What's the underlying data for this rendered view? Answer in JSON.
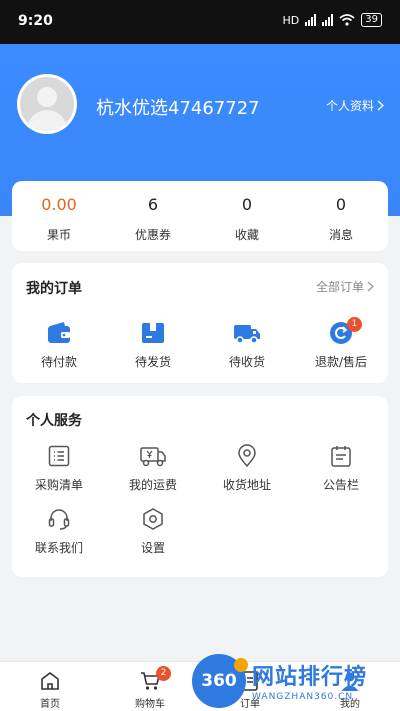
{
  "status_bar": {
    "time": "9:20",
    "network": "HD",
    "battery": "39"
  },
  "profile": {
    "username": "杭水优选47467727",
    "profile_link": "个人资料"
  },
  "stats": [
    {
      "value": "0.00",
      "label": "果币"
    },
    {
      "value": "6",
      "label": "优惠券"
    },
    {
      "value": "0",
      "label": "收藏"
    },
    {
      "value": "0",
      "label": "消息"
    }
  ],
  "orders": {
    "title": "我的订单",
    "all_label": "全部订单",
    "items": [
      {
        "label": "待付款",
        "icon": "wallet-icon"
      },
      {
        "label": "待发货",
        "icon": "box-icon"
      },
      {
        "label": "待收货",
        "icon": "truck-icon"
      },
      {
        "label": "退款/售后",
        "icon": "refund-icon",
        "badge": "1"
      }
    ]
  },
  "services": {
    "title": "个人服务",
    "items": [
      {
        "label": "采购清单",
        "icon": "list-icon"
      },
      {
        "label": "我的运费",
        "icon": "freight-truck-icon"
      },
      {
        "label": "收货地址",
        "icon": "location-pin-icon"
      },
      {
        "label": "公告栏",
        "icon": "notice-board-icon"
      },
      {
        "label": "联系我们",
        "icon": "headset-icon"
      },
      {
        "label": "设置",
        "icon": "hexagon-settings-icon"
      }
    ]
  },
  "tabbar": [
    {
      "label": "首页",
      "icon": "home-icon"
    },
    {
      "label": "购物车",
      "icon": "cart-icon",
      "badge": "2"
    },
    {
      "label": "订单",
      "icon": "order-doc-icon"
    },
    {
      "label": "我的",
      "icon": "user-icon"
    }
  ],
  "watermark": {
    "logo": "360",
    "title": "网站排行榜",
    "subtitle": "WANGZHAN360.CN"
  },
  "colors": {
    "primary": "#3a86f8",
    "accent_orange": "#e8621d",
    "badge_red": "#e9522a"
  }
}
